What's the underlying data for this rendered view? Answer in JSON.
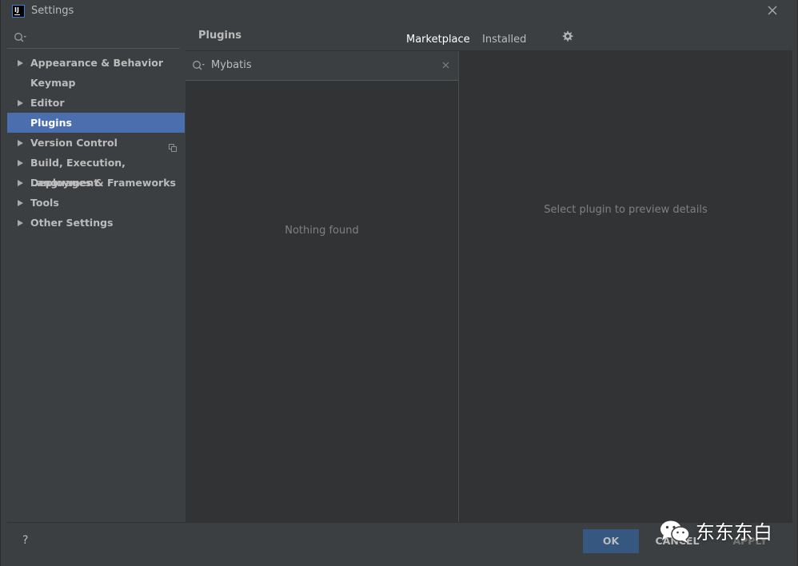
{
  "window": {
    "title": "Settings"
  },
  "sidebar": {
    "items": [
      {
        "label": "Appearance & Behavior",
        "expandable": true
      },
      {
        "label": "Keymap",
        "expandable": false
      },
      {
        "label": "Editor",
        "expandable": true
      },
      {
        "label": "Plugins",
        "expandable": false,
        "selected": true
      },
      {
        "label": "Version Control",
        "expandable": true
      },
      {
        "label": "Build, Execution, Deployment",
        "expandable": true
      },
      {
        "label": "Languages & Frameworks",
        "expandable": true
      },
      {
        "label": "Tools",
        "expandable": true
      },
      {
        "label": "Other Settings",
        "expandable": true
      }
    ]
  },
  "header": {
    "title": "Plugins",
    "tabs": [
      {
        "label": "Marketplace",
        "active": true
      },
      {
        "label": "Installed",
        "active": false
      }
    ]
  },
  "plugin_list": {
    "search_value": "Mybatis",
    "empty_text": "Nothing found"
  },
  "detail": {
    "hint": "Select plugin to preview details"
  },
  "footer": {
    "help_label": "?",
    "ok_label": "OK",
    "cancel_label": "CANCEL",
    "apply_label": "APPLY"
  },
  "watermark": {
    "text": "东东东白"
  },
  "colors": {
    "background": "#3c3f41",
    "panel": "#313335",
    "selection": "#4b6eaf",
    "ok_button": "#365880",
    "text": "#bbbbbb",
    "muted_text": "#808080"
  }
}
